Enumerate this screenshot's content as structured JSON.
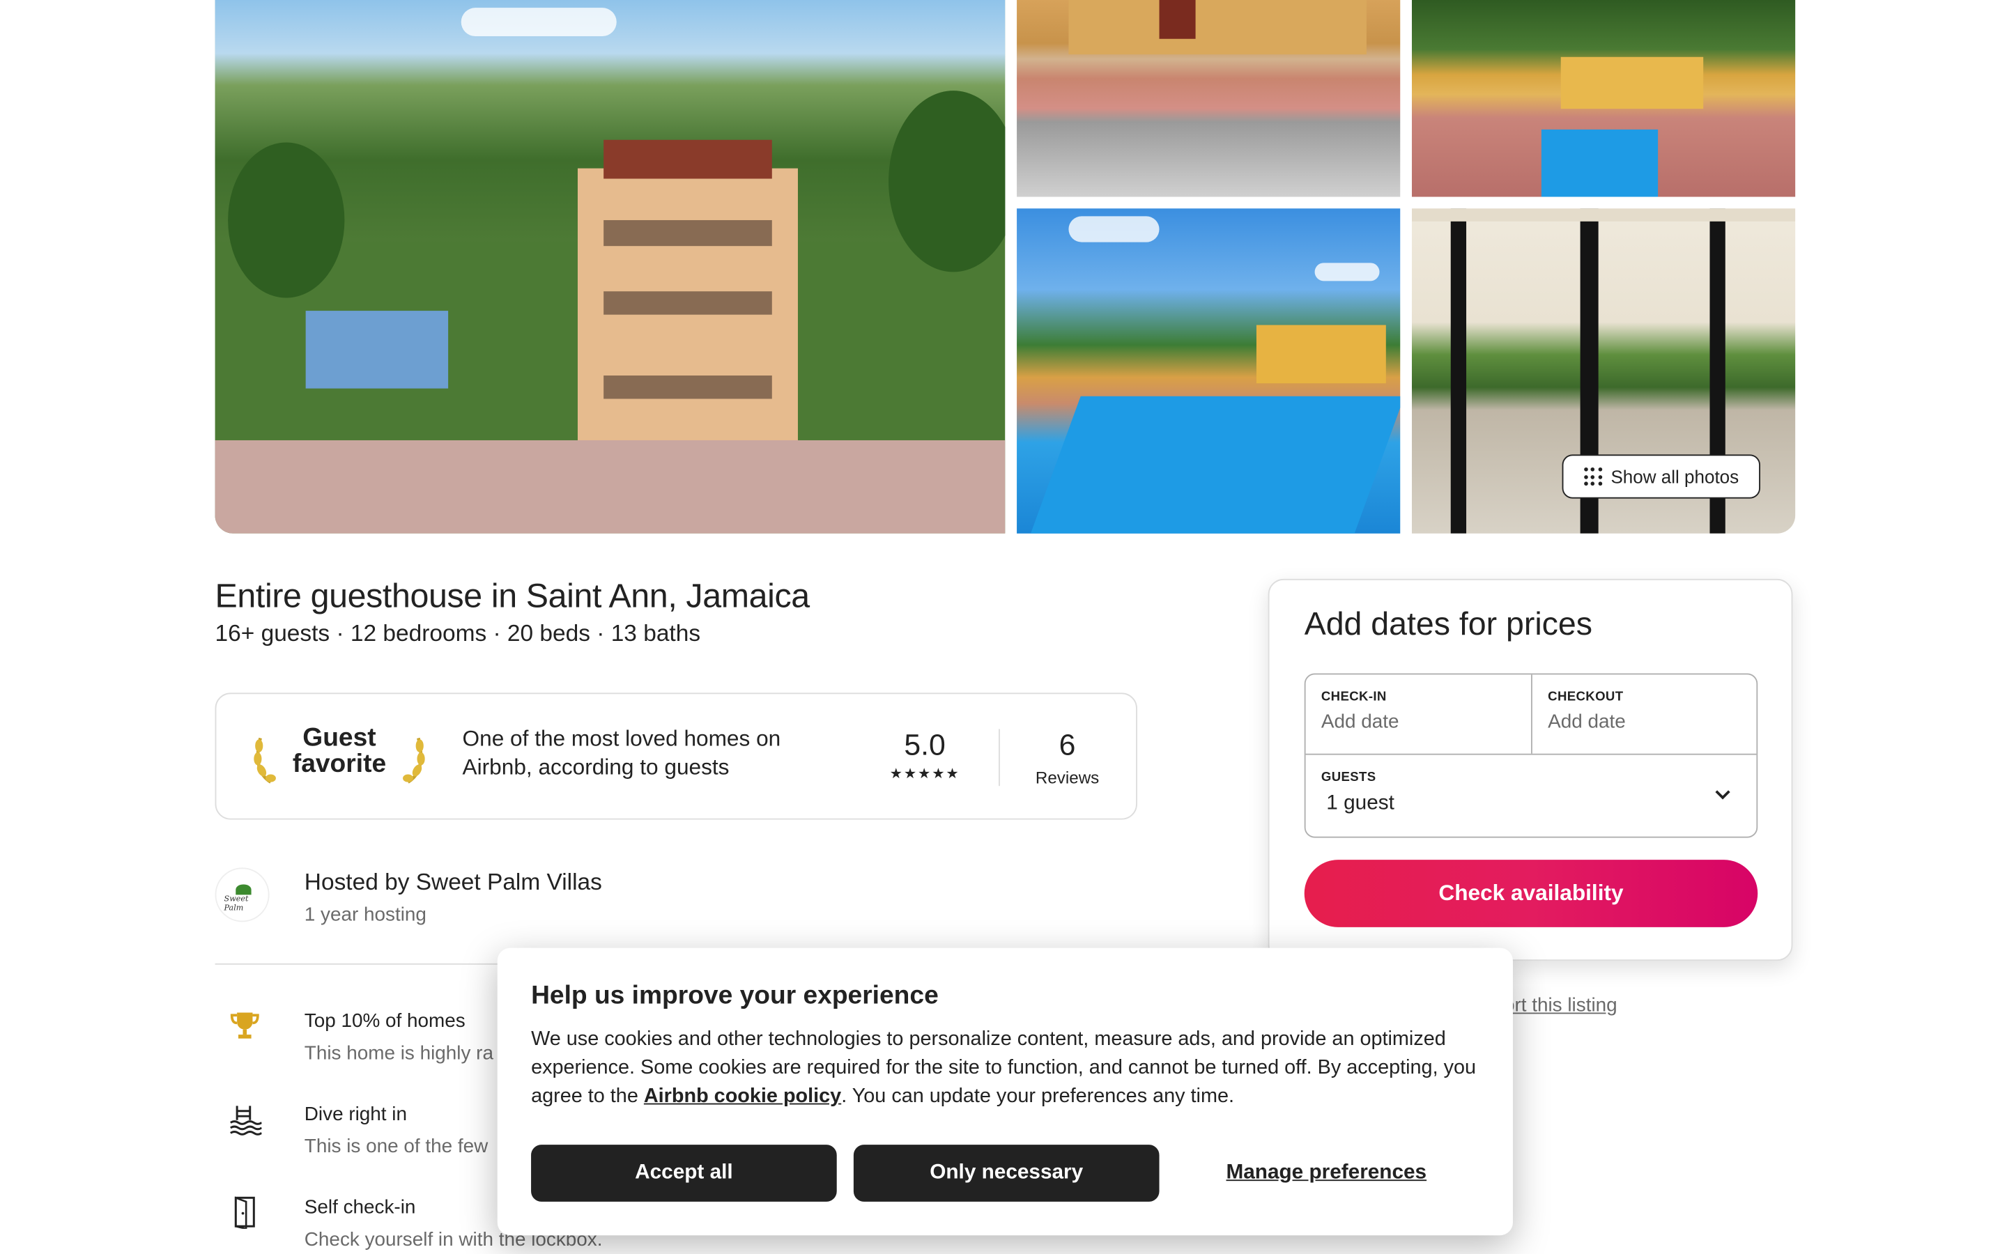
{
  "gallery": {
    "show_all_label": "Show all photos"
  },
  "listing": {
    "title": "Entire guesthouse in Saint Ann, Jamaica",
    "overview": "16+ guests · 12 bedrooms · 20 beds · 13 baths"
  },
  "guest_favorite": {
    "label_line1": "Guest",
    "label_line2": "favorite",
    "description": "One of the most loved homes on Airbnb, according to guests",
    "rating": "5.0",
    "stars": "★★★★★",
    "review_count": "6",
    "reviews_label": "Reviews"
  },
  "host": {
    "avatar_text": "Sweet Palm",
    "name": "Hosted by Sweet Palm Villas",
    "tenure": "1 year hosting"
  },
  "highlights": [
    {
      "icon": "trophy-icon",
      "title": "Top 10% of homes",
      "description": "This home is highly ra"
    },
    {
      "icon": "pool-icon",
      "title": "Dive right in",
      "description": "This is one of the few"
    },
    {
      "icon": "door-icon",
      "title": "Self check-in",
      "description": "Check yourself in with the lockbox."
    }
  ],
  "booking": {
    "title": "Add dates for prices",
    "checkin_label": "CHECK-IN",
    "checkin_placeholder": "Add date",
    "checkout_label": "CHECKOUT",
    "checkout_placeholder": "Add date",
    "guests_label": "GUESTS",
    "guests_value": "1 guest",
    "cta": "Check availability",
    "accent_color": "#e31c5f"
  },
  "report": {
    "label": "ort this listing"
  },
  "cookie_banner": {
    "title": "Help us improve your experience",
    "body_before_link": "We use cookies and other technologies to personalize content, measure ads, and provide an optimized experience. Some cookies are required for the site to function, and cannot be turned off. By accepting, you agree to the ",
    "link_text": "Airbnb cookie policy",
    "body_after_link": ". You can update your preferences any time.",
    "accept_label": "Accept all",
    "necessary_label": "Only necessary",
    "manage_label": "Manage preferences"
  }
}
